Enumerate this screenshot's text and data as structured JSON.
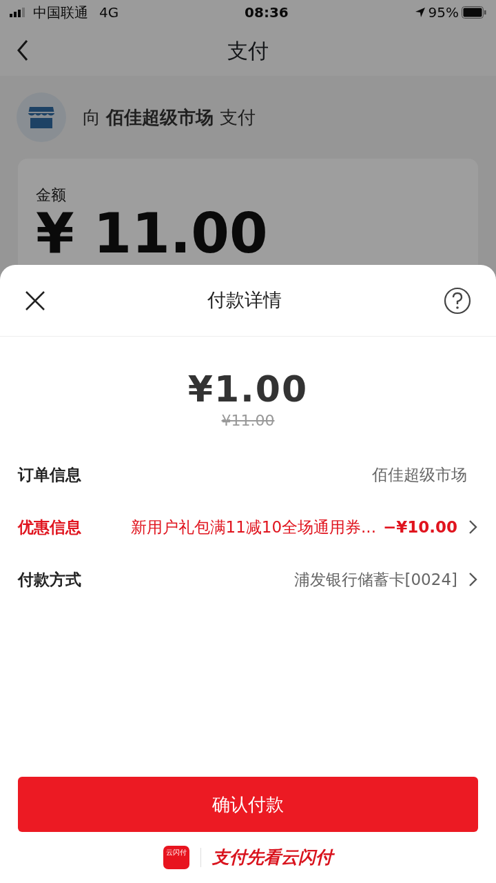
{
  "status_bar": {
    "carrier": "中国联通",
    "network": "4G",
    "time": "08:36",
    "battery": "95%"
  },
  "nav": {
    "title": "支付"
  },
  "merchant": {
    "text": "向 **佰佳超级市场** 支付"
  },
  "amount_card": {
    "label": "金额",
    "value": "¥ 11.00"
  },
  "sheet": {
    "title": "付款详情",
    "amount": "¥1.00",
    "original_amount": "¥11.00",
    "rows": [
      {
        "kind": "info",
        "label": "订单信息",
        "value": "佰佳超级市场"
      },
      {
        "kind": "discount",
        "label": "优惠信息",
        "value": "新用户礼包满11减10全场通用券...",
        "amount": "−¥10.00"
      },
      {
        "kind": "select",
        "label": "付款方式",
        "value": "浦发银行储蓄卡[0024]"
      }
    ],
    "confirm_button": "确认付款"
  },
  "footer": {
    "app_icon_text": "云闪付",
    "slogan": "支付先看云闪付"
  }
}
